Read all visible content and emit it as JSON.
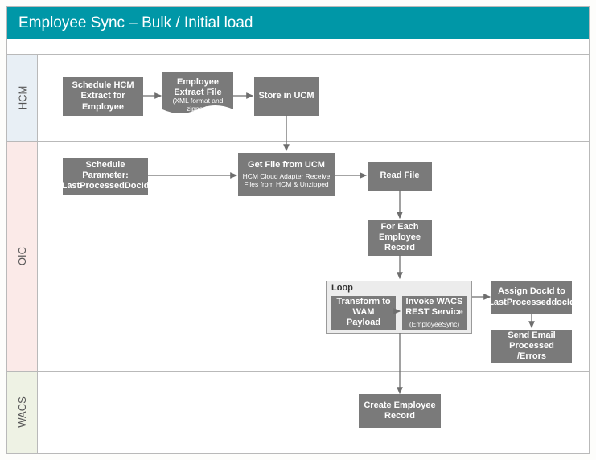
{
  "title": "Employee Sync – Bulk / Initial load",
  "lanes": {
    "hcm": "HCM",
    "oic": "OIC",
    "wacs": "WACS"
  },
  "hcm": {
    "schedule_extract": "Schedule HCM Extract for Employee",
    "extract_file": {
      "main": "Employee Extract File",
      "sub": "(XML format and zipped)"
    },
    "store_ucm": "Store in UCM"
  },
  "oic": {
    "schedule_param": {
      "main": "Schedule Parameter:",
      "sub": "LastProcessedDocId"
    },
    "get_file": {
      "main": "Get File from UCM",
      "sub": "HCM Cloud Adapter Receive Files from HCM & Unzipped"
    },
    "read_file": "Read File",
    "for_each": "For Each Employee Record",
    "loop_label": "Loop",
    "transform": "Transform to WAM Payload",
    "invoke": {
      "main": "Invoke WACS REST Service",
      "sub": "(EmployeeSync)"
    },
    "assign_docid": "Assign DocId to LastProcesseddocId",
    "send_email": "Send Email Processed /Errors"
  },
  "wacs": {
    "create_record": "Create Employee Record"
  }
}
